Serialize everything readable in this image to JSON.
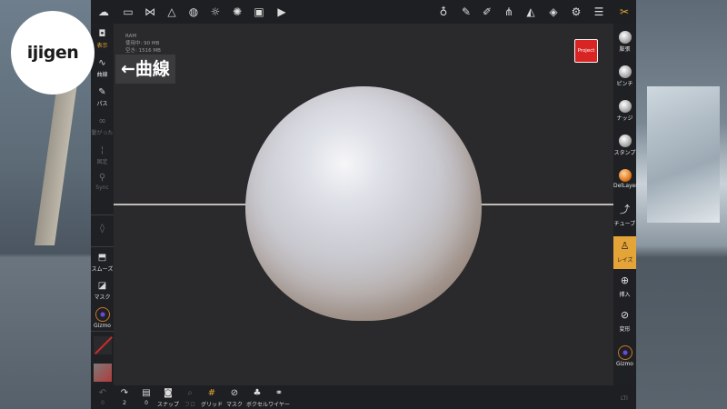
{
  "viewport": {
    "stats": [
      "RAM",
      "使用中: 90 MB",
      "空き: 1516 MB"
    ]
  },
  "overlay": {
    "logo_text": "ijigen",
    "callout_text": "←曲線",
    "project_label": "Project"
  },
  "top_toolbar": {
    "icons": [
      "menu-icon",
      "folder-icon",
      "share-icon",
      "mesh-icon",
      "globe-icon",
      "sun-icon",
      "render-icon",
      "image-icon",
      "camera-icon",
      "bucket-icon",
      "brush-icon",
      "picker-icon",
      "symmetry-icon",
      "triangle-icon",
      "layers-icon",
      "settings-icon",
      "sliders-icon",
      "tools-icon"
    ]
  },
  "left_panel": {
    "items": [
      {
        "label": "表示",
        "icon": "camera-icon"
      },
      {
        "label": "曲線",
        "icon": "curve-icon"
      },
      {
        "label": "パス",
        "icon": "path-icon"
      },
      {
        "label": "繋がった",
        "icon": "link-icon"
      },
      {
        "label": "固定",
        "icon": "lock-icon"
      },
      {
        "label": "Sync",
        "icon": "sync-icon"
      },
      {
        "label": "スムーズ",
        "icon": "smooth-icon"
      },
      {
        "label": "マスク",
        "icon": "mask-icon"
      },
      {
        "label": "Gizmo",
        "icon": "gizmo-icon"
      }
    ]
  },
  "right_panel": {
    "items": [
      {
        "label": "膨張",
        "icon": "inflate-icon"
      },
      {
        "label": "ピンチ",
        "icon": "pinch-icon"
      },
      {
        "label": "ナッジ",
        "icon": "nudge-icon"
      },
      {
        "label": "スタンプ",
        "icon": "stamp-icon"
      },
      {
        "label": "DelLayer",
        "icon": "dellayer-icon"
      },
      {
        "label": "チューブ",
        "icon": "tube-icon"
      },
      {
        "label": "レイズ",
        "icon": "raise-icon",
        "active": true
      },
      {
        "label": "挿入",
        "icon": "insert-icon"
      },
      {
        "label": "変形",
        "icon": "transform-icon"
      },
      {
        "label": "Gizmo",
        "icon": "gizmo-icon"
      }
    ]
  },
  "bottom_bar": {
    "items": [
      {
        "label": "0",
        "icon": "undo-icon"
      },
      {
        "label": "2",
        "icon": "redo-icon"
      },
      {
        "label": "0",
        "icon": "file-icon"
      },
      {
        "label": "スナップ",
        "icon": "snap-icon"
      },
      {
        "label": "フロ",
        "icon": "focus-icon"
      },
      {
        "label": "グリッド",
        "icon": "grid-icon"
      },
      {
        "label": "マスク",
        "icon": "mask-icon"
      },
      {
        "label": "ボクセル",
        "icon": "voxel-icon"
      },
      {
        "label": "ワイヤー",
        "icon": "wire-icon"
      }
    ],
    "corner_text": "LTI"
  },
  "colors": {
    "accent": "#e4a437",
    "project": "#d92424",
    "panel": "#1f2023"
  }
}
